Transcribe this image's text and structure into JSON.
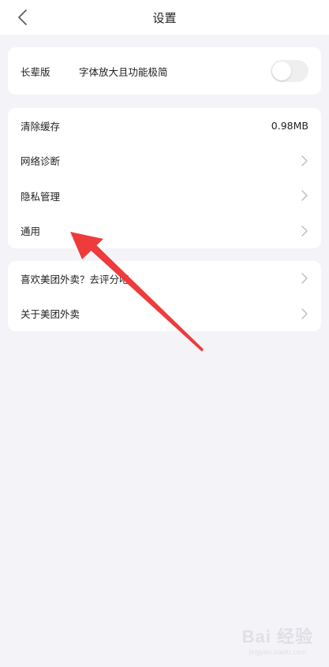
{
  "header": {
    "title": "设置",
    "back_icon": "chevron-left-icon"
  },
  "senior_mode": {
    "label": "长辈版",
    "description": "字体放大且功能极简",
    "enabled": false
  },
  "settings_group": [
    {
      "label": "清除缓存",
      "value": "0.98MB"
    },
    {
      "label": "网络诊断",
      "icon": "chevron-right-icon"
    },
    {
      "label": "隐私管理",
      "icon": "chevron-right-icon"
    },
    {
      "label": "通用",
      "icon": "chevron-right-icon"
    }
  ],
  "about_group": [
    {
      "label": "喜欢美团外卖？去评分吧",
      "icon": "chevron-right-icon"
    },
    {
      "label": "关于美团外卖",
      "icon": "chevron-right-icon"
    }
  ],
  "annotation": {
    "arrow_color": "#ee3b3b"
  },
  "watermark": {
    "main": "Bai 经验",
    "sub": "jingyan.baidu.com"
  },
  "colors": {
    "background": "#f4f4f8",
    "card": "#ffffff",
    "text": "#222222",
    "chevron": "#b9b9b9"
  }
}
